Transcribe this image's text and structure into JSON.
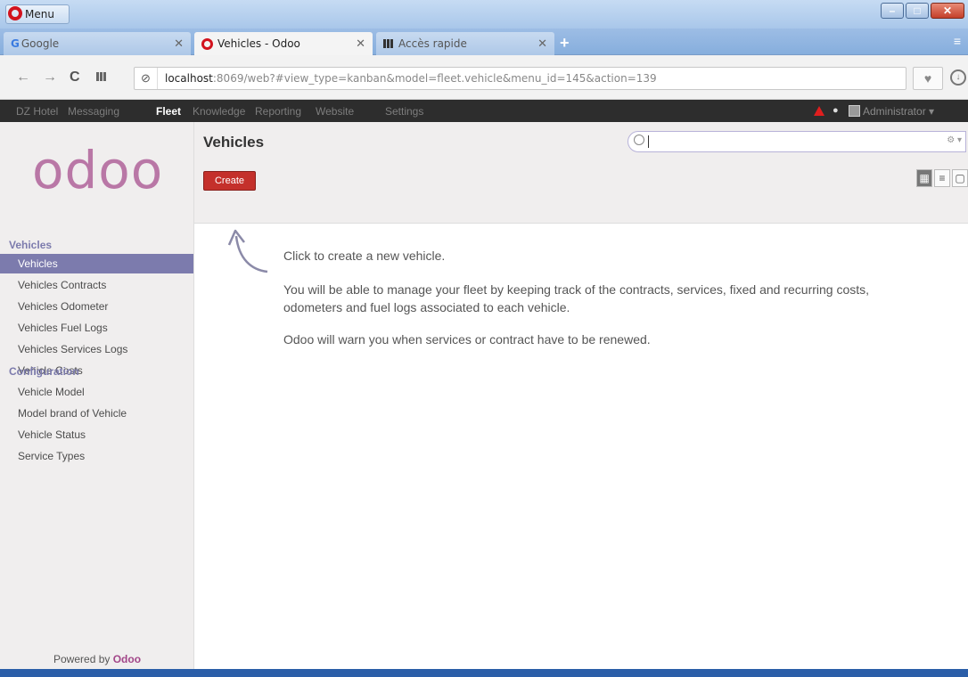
{
  "browser": {
    "menu_label": "Menu",
    "tabs": [
      {
        "label": "Google",
        "icon": "G"
      },
      {
        "label": "Vehicles - Odoo",
        "icon": "opera-o"
      },
      {
        "label": "Accès rapide",
        "icon": "speed-dial"
      }
    ],
    "url_host": "localhost",
    "url_rest": ":8069/web?#view_type=kanban&model=fleet.vehicle&menu_id=145&action=139"
  },
  "topmenu": {
    "items": [
      "DZ Hotel",
      "Messaging",
      "Fleet",
      "Knowledge",
      "Reporting",
      "Website",
      "Settings"
    ],
    "active": "Fleet",
    "user": "Administrator"
  },
  "sidebar": {
    "sections": [
      {
        "title": "Vehicles",
        "items": [
          "Vehicles",
          "Vehicles Contracts",
          "Vehicles Odometer",
          "Vehicles Fuel Logs",
          "Vehicles Services Logs",
          "Vehicle Costs"
        ]
      },
      {
        "title": "Configuration",
        "items": [
          "Vehicle Model",
          "Model brand of Vehicle",
          "Vehicle Status",
          "Service Types"
        ]
      }
    ],
    "powered_prefix": "Powered by ",
    "powered_brand": "Odoo",
    "logo": "odoo"
  },
  "main": {
    "title": "Vehicles",
    "create_label": "Create",
    "help": [
      "Click to create a new vehicle.",
      "You will be able to manage your fleet by keeping track of the contracts, services, fixed and recurring costs, odometers and fuel logs associated to each vehicle.",
      "Odoo will warn you when services or contract have to be renewed."
    ]
  },
  "colors": {
    "accent": "#7c7bad",
    "brand": "#a24689",
    "create": "#c4302b"
  }
}
